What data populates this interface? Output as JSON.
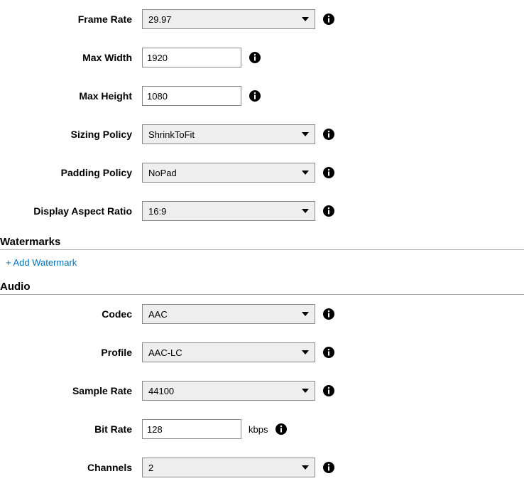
{
  "video": {
    "frame_rate_label": "Frame Rate",
    "frame_rate_value": "29.97",
    "max_width_label": "Max Width",
    "max_width_value": "1920",
    "max_height_label": "Max Height",
    "max_height_value": "1080",
    "sizing_policy_label": "Sizing Policy",
    "sizing_policy_value": "ShrinkToFit",
    "padding_policy_label": "Padding Policy",
    "padding_policy_value": "NoPad",
    "display_aspect_ratio_label": "Display Aspect Ratio",
    "display_aspect_ratio_value": "16:9"
  },
  "watermarks": {
    "header": "Watermarks",
    "add_link": "+ Add Watermark"
  },
  "audio": {
    "header": "Audio",
    "codec_label": "Codec",
    "codec_value": "AAC",
    "profile_label": "Profile",
    "profile_value": "AAC-LC",
    "sample_rate_label": "Sample Rate",
    "sample_rate_value": "44100",
    "bit_rate_label": "Bit Rate",
    "bit_rate_value": "128",
    "bit_rate_unit": "kbps",
    "channels_label": "Channels",
    "channels_value": "2"
  }
}
